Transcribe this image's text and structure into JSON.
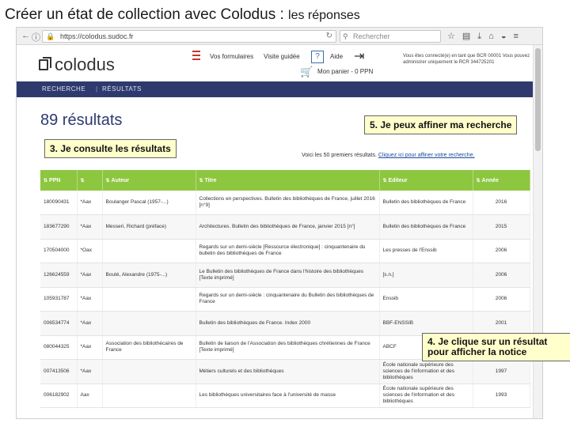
{
  "slide": {
    "title_main": "Créer un état de collection avec Colodus : ",
    "title_small": "les réponses"
  },
  "browser": {
    "url": "https://colodus.sudoc.fr",
    "search_placeholder": "Rechercher"
  },
  "site": {
    "logo": "colodus",
    "links": {
      "formulaires": "Vos formulaires",
      "visite": "Visite guidée",
      "aide": "Aide"
    },
    "help_symbol": "?",
    "panier": "Mon panier - 0 PPN",
    "notice": "Vous êtes connecté(e) en tant que BCR 00001 Vous pouvez administrer uniquement le RCR 344725201"
  },
  "nav": {
    "crumb1": "RECHERCHE",
    "crumb2": "RÉSULTATS",
    "sep": "|"
  },
  "results": {
    "title": "89 résultats",
    "intro": "Voici les 50 premiers résultats.",
    "intro_link": "Cliquez ici pour affiner votre recherche."
  },
  "table": {
    "columns": [
      "PPN",
      "",
      "Auteur",
      "Titre",
      "Editeur",
      "Année"
    ],
    "rows": [
      [
        "180090431",
        "*Aax",
        "Boulanger Pascal (1957-...)",
        "Collections en perspectives. Bulletin des bibliothèques de France, juillet 2016 [n°9]",
        "Bulletin des bibliothèques de France",
        "2016"
      ],
      [
        "183677290",
        "*Aax",
        "Messeri, Richard (préface)",
        "Architectures. Bulletin des bibliothèques de France, janvier 2015 [n°]",
        "Bulletin des bibliothèques de France",
        "2015"
      ],
      [
        "170504000",
        "*Oax",
        "",
        "Regards sur un demi-siècle [Ressource électronique] : cinquantenaire du bulletin des bibliothèques de France",
        "Les presses de l'Enssib",
        "2006"
      ],
      [
        "126624559",
        "*Aax",
        "Bouté, Alexandre (1975-...)",
        "Le Bulletin des bibliothèques de France dans l'histoire des bibliothèques [Texte imprimé]",
        "[s.n.]",
        "2006"
      ],
      [
        "105931787",
        "*Aax",
        "",
        "Regards sur un demi-siècle : cinquantenaire du Bulletin des bibliothèques de France",
        "Enssib",
        "2006"
      ],
      [
        "006534774",
        "*Aax",
        "",
        "Bulletin des bibliothèques de France. Index 2000",
        "BBF-ENSSIB",
        "2001"
      ],
      [
        "080044325",
        "*Aax",
        "Association des bibliothécaires de France",
        "Bulletin de liaison de l'Association des bibliothèques chrétiennes de France [Texte imprimé]",
        "ABCF",
        ""
      ],
      [
        "007413506",
        "*Aax",
        "",
        "Métiers culturels et des bibliothèques",
        "École nationale supérieure des sciences de l'information et des bibliothèques",
        "1997"
      ],
      [
        "006182902",
        "Aax",
        "",
        "Les bibliothèques universitaires face à l'université de masse",
        "École nationale supérieure des sciences de l'information et des bibliothèques",
        "1993"
      ]
    ]
  },
  "callouts": {
    "c5": "5. Je peux affiner ma recherche",
    "c3": "3. Je consulte les résultats",
    "c4": "4. Je clique sur un résultat pour afficher la notice"
  },
  "icons": [
    "lock-icon",
    "reload-icon",
    "search-icon",
    "star-icon",
    "bookmark-icon",
    "download-icon",
    "home-icon",
    "pocket-icon",
    "menu-icon",
    "logout-icon",
    "basket-icon",
    "sort-icon"
  ]
}
